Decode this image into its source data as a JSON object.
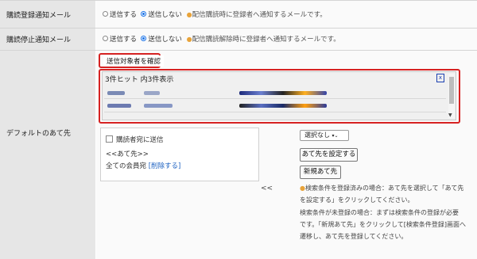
{
  "rows": [
    {
      "label": "購読登録通知メール",
      "send": "送信する",
      "nosend": "送信しない",
      "hint": "配信購読時に登録者へ通知するメールです。"
    },
    {
      "label": "購読停止通知メール",
      "send": "送信する",
      "nosend": "送信しない",
      "hint": "配信購読解除時に登録者へ通知するメールです。"
    }
  ],
  "default_recipient": {
    "label": "デフォルトのあて先",
    "confirm_button": "送信対象者を確認",
    "hits": {
      "title": "3件ヒット 内3件表示",
      "close": "x"
    },
    "subscriber_checkbox": "購読者宛に送信",
    "recipient_header": "<<あて先>>",
    "all_members": "全ての会員宛",
    "delete_link": "[削除する]",
    "move_left": "<<",
    "select_value": "選択なし",
    "set_button": "あて先を設定する",
    "new_button": "新規あて先",
    "notes": [
      "検索条件を登録済みの場合：あて先を選択して「あて先",
      "を設定する」をクリックしてください。",
      "検索条件が未登録の場合：まずは検索条件の登録が必要",
      "です。「新規あて先」をクリックして[検索条件登録]画面へ",
      "遷移し、あて先を登録してください。"
    ]
  },
  "colors": {
    "highlight": "#d62222",
    "radio_selected": "#1a73e8",
    "link": "#1a5fc0"
  }
}
